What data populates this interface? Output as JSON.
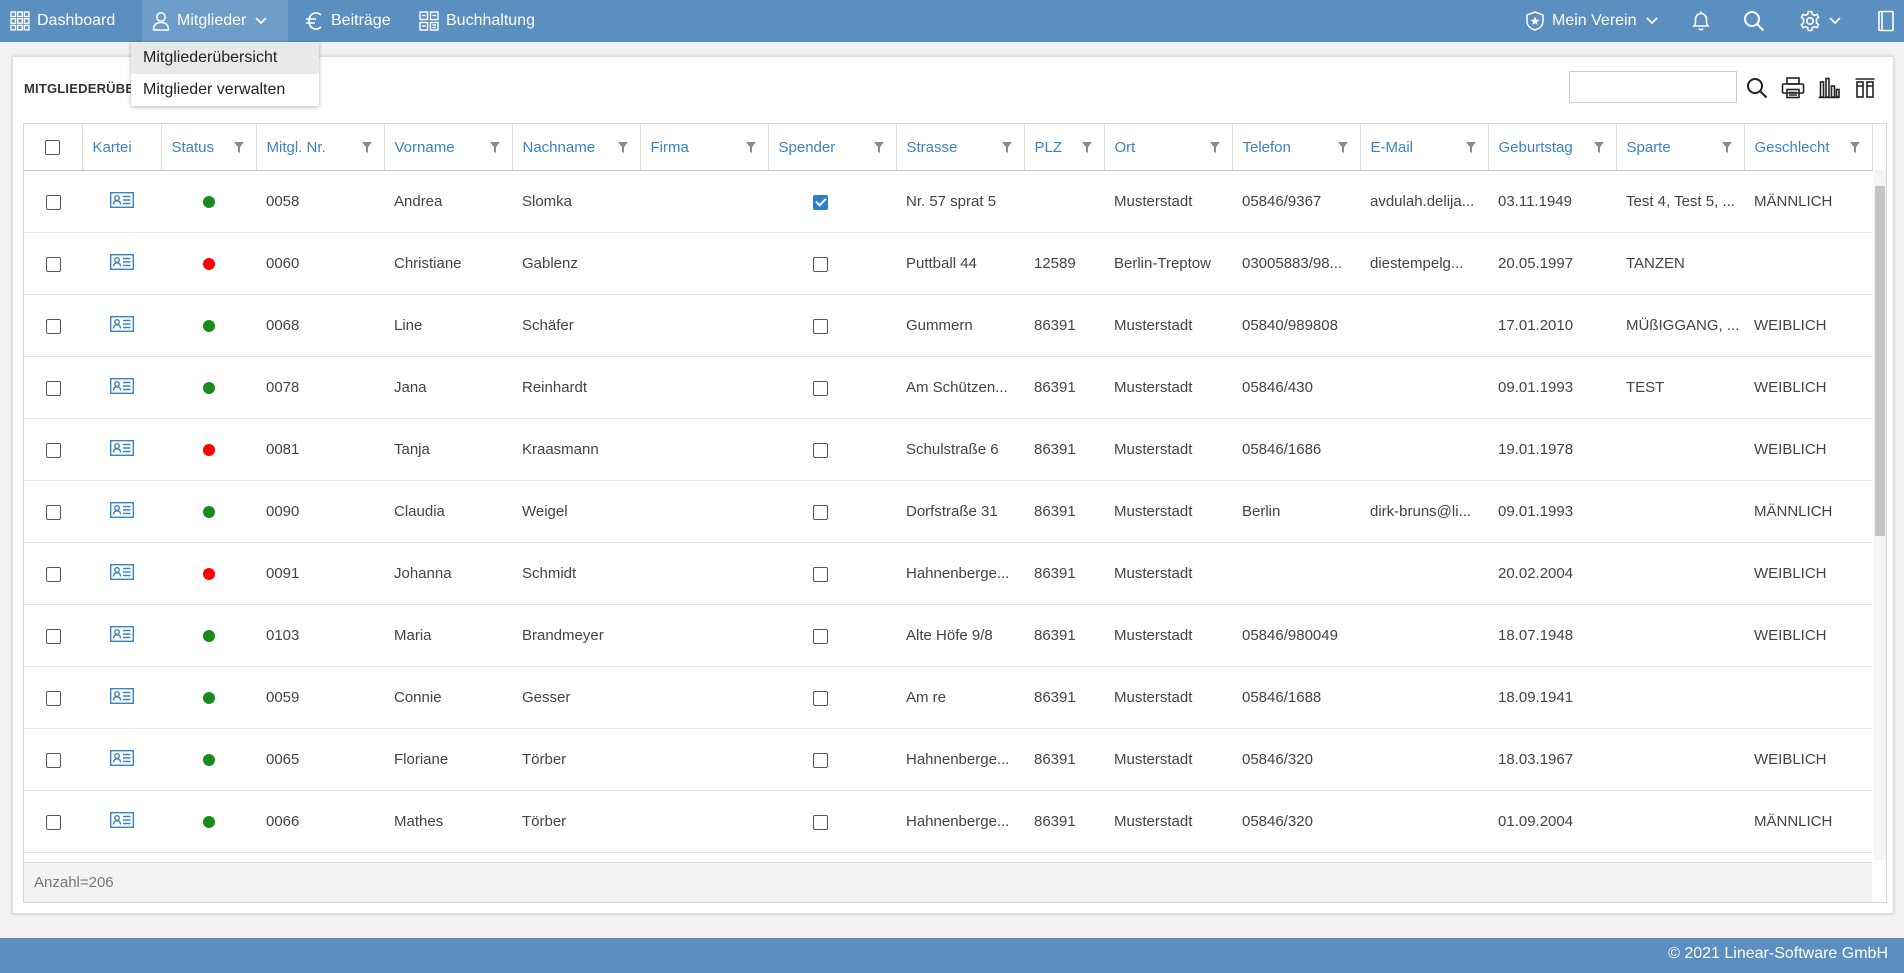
{
  "nav": {
    "dashboard": "Dashboard",
    "mitglieder": "Mitglieder",
    "beitraege": "Beiträge",
    "buchhaltung": "Buchhaltung",
    "verein": "Mein Verein"
  },
  "dropdown": {
    "items": [
      "Mitgliederübersicht",
      "Mitglieder verwalten"
    ]
  },
  "panel": {
    "title": "MITGLIEDERÜBE"
  },
  "search": {
    "value": "",
    "placeholder": ""
  },
  "columns": [
    "Kartei",
    "Status",
    "Mitgl. Nr.",
    "Vorname",
    "Nachname",
    "Firma",
    "Spender",
    "Strasse",
    "PLZ",
    "Ort",
    "Telefon",
    "E-Mail",
    "Geburtstag",
    "Sparte",
    "Geschlecht"
  ],
  "colors": {
    "active": "#1a8a1a",
    "inactive": "#ff0000",
    "accent": "#3a84c4",
    "bar": "#5b8fbf"
  },
  "rows": [
    {
      "status": "active",
      "nr": "0058",
      "vorname": "Andrea",
      "nachname": "Slomka",
      "firma": "",
      "spender": true,
      "strasse": "Nr. 57 sprat 5",
      "plz": "",
      "ort": "Musterstadt",
      "telefon": "05846/9367",
      "email": "avdulah.delija...",
      "geburtstag": "03.11.1949",
      "sparte": "Test 4, Test 5, ...",
      "geschlecht": "MÄNNLICH"
    },
    {
      "status": "inactive",
      "nr": "0060",
      "vorname": "Christiane",
      "nachname": "Gablenz",
      "firma": "",
      "spender": false,
      "strasse": "Puttball 44",
      "plz": "12589",
      "ort": "Berlin-Treptow",
      "telefon": "03005883/98...",
      "email": "diestempelg...",
      "geburtstag": "20.05.1997",
      "sparte": "TANZEN",
      "geschlecht": ""
    },
    {
      "status": "active",
      "nr": "0068",
      "vorname": "Line",
      "nachname": "Schäfer",
      "firma": "",
      "spender": false,
      "strasse": "Gummern",
      "plz": "86391",
      "ort": "Musterstadt",
      "telefon": "05840/989808",
      "email": "",
      "geburtstag": "17.01.2010",
      "sparte": "MÜßIGGANG, ...",
      "geschlecht": "WEIBLICH"
    },
    {
      "status": "active",
      "nr": "0078",
      "vorname": "Jana",
      "nachname": "Reinhardt",
      "firma": "",
      "spender": false,
      "strasse": "Am Schützen...",
      "plz": "86391",
      "ort": "Musterstadt",
      "telefon": "05846/430",
      "email": "",
      "geburtstag": "09.01.1993",
      "sparte": "TEST",
      "geschlecht": "WEIBLICH"
    },
    {
      "status": "inactive",
      "nr": "0081",
      "vorname": "Tanja",
      "nachname": "Kraasmann",
      "firma": "",
      "spender": false,
      "strasse": "Schulstraße 6",
      "plz": "86391",
      "ort": "Musterstadt",
      "telefon": "05846/1686",
      "email": "",
      "geburtstag": "19.01.1978",
      "sparte": "",
      "geschlecht": "WEIBLICH"
    },
    {
      "status": "active",
      "nr": "0090",
      "vorname": "Claudia",
      "nachname": "Weigel",
      "firma": "",
      "spender": false,
      "strasse": "Dorfstraße 31",
      "plz": "86391",
      "ort": "Musterstadt",
      "telefon": "Berlin",
      "email": "dirk-bruns@li...",
      "geburtstag": "09.01.1993",
      "sparte": "",
      "geschlecht": "MÄNNLICH"
    },
    {
      "status": "inactive",
      "nr": "0091",
      "vorname": "Johanna",
      "nachname": "Schmidt",
      "firma": "",
      "spender": false,
      "strasse": "Hahnenberge...",
      "plz": "86391",
      "ort": "Musterstadt",
      "telefon": "",
      "email": "",
      "geburtstag": "20.02.2004",
      "sparte": "",
      "geschlecht": "WEIBLICH"
    },
    {
      "status": "active",
      "nr": "0103",
      "vorname": "Maria",
      "nachname": "Brandmeyer",
      "firma": "",
      "spender": false,
      "strasse": "Alte Höfe 9/8",
      "plz": "86391",
      "ort": "Musterstadt",
      "telefon": "05846/980049",
      "email": "",
      "geburtstag": "18.07.1948",
      "sparte": "",
      "geschlecht": "WEIBLICH"
    },
    {
      "status": "active",
      "nr": "0059",
      "vorname": "Connie",
      "nachname": "Gesser",
      "firma": "",
      "spender": false,
      "strasse": "Am re",
      "plz": "86391",
      "ort": "Musterstadt",
      "telefon": "05846/1688",
      "email": "",
      "geburtstag": "18.09.1941",
      "sparte": "",
      "geschlecht": ""
    },
    {
      "status": "active",
      "nr": "0065",
      "vorname": "Floriane",
      "nachname": "Törber",
      "firma": "",
      "spender": false,
      "strasse": "Hahnenberge...",
      "plz": "86391",
      "ort": "Musterstadt",
      "telefon": "05846/320",
      "email": "",
      "geburtstag": "18.03.1967",
      "sparte": "",
      "geschlecht": "WEIBLICH"
    },
    {
      "status": "active",
      "nr": "0066",
      "vorname": "Mathes",
      "nachname": "Törber",
      "firma": "",
      "spender": false,
      "strasse": "Hahnenberge...",
      "plz": "86391",
      "ort": "Musterstadt",
      "telefon": "05846/320",
      "email": "",
      "geburtstag": "01.09.2004",
      "sparte": "",
      "geschlecht": "MÄNNLICH"
    }
  ],
  "count": "Anzahl=206",
  "footer": "© 2021 Linear-Software GmbH",
  "icons": [
    "grid-icon",
    "user-icon",
    "chevron-down-icon",
    "euro-icon",
    "ledger-icon",
    "shield-star-icon",
    "bell-icon",
    "search-icon",
    "gear-icon",
    "book-icon",
    "print-icon",
    "chart-icon",
    "columns-icon",
    "filter-icon",
    "member-card-icon"
  ]
}
